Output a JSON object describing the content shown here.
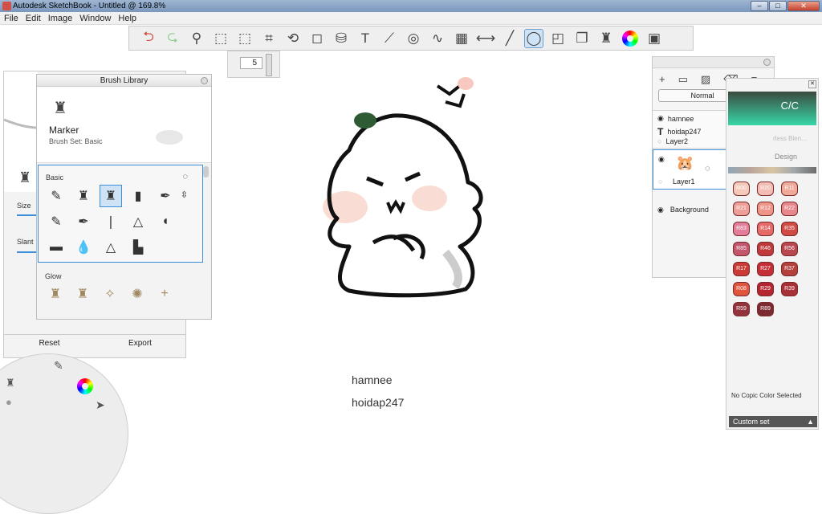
{
  "window": {
    "title": "Autodesk SketchBook - Untitled @ 169.8%",
    "min": "–",
    "max": "□",
    "close": "✕"
  },
  "menu": [
    "File",
    "Edit",
    "Image",
    "Window",
    "Help"
  ],
  "toolbar": {
    "brush_size": "5"
  },
  "left_panel": {
    "size_label": "Size",
    "slant_label": "Slant",
    "reset": "Reset",
    "export": "Export"
  },
  "brush_library": {
    "title": "Brush Library",
    "brush_name": "Marker",
    "brush_set": "Brush Set: Basic",
    "section_basic": "Basic",
    "section_glow": "Glow"
  },
  "canvas": {
    "text1": "hamnee",
    "text2": "hoidap247"
  },
  "layers": {
    "blend_mode": "Normal",
    "opacity": "100",
    "text_layer1": "hamnee",
    "text_layer2": "hoidap247",
    "layer2": "Layer2",
    "layer1": "Layer1",
    "background": "Background"
  },
  "copic": {
    "logo_text": "C/C",
    "faded_text": "rless Blen...",
    "tab_design": "Design",
    "swatches": [
      {
        "code": "R00",
        "color": "#f5c9b9"
      },
      {
        "code": "R20",
        "color": "#f3bcb4"
      },
      {
        "code": "R11",
        "color": "#f1a99a"
      },
      {
        "code": "R21",
        "color": "#ee9f98"
      },
      {
        "code": "R12",
        "color": "#ef9587"
      },
      {
        "code": "R22",
        "color": "#e7868b"
      },
      {
        "code": "R83",
        "color": "#e27e9a"
      },
      {
        "code": "R14",
        "color": "#e56a68"
      },
      {
        "code": "R35",
        "color": "#d14b45"
      },
      {
        "code": "R85",
        "color": "#c2566d"
      },
      {
        "code": "R46",
        "color": "#c0393b"
      },
      {
        "code": "R56",
        "color": "#b8474f"
      },
      {
        "code": "R17",
        "color": "#cc3a37"
      },
      {
        "code": "R27",
        "color": "#c52e36"
      },
      {
        "code": "R37",
        "color": "#b3403b"
      },
      {
        "code": "R08",
        "color": "#e0553b"
      },
      {
        "code": "R29",
        "color": "#b42530"
      },
      {
        "code": "R39",
        "color": "#a73137"
      },
      {
        "code": "R59",
        "color": "#93343d"
      },
      {
        "code": "R89",
        "color": "#7b2a31"
      }
    ],
    "no_color": "No Copic Color Selected",
    "custom_set": "Custom set"
  }
}
